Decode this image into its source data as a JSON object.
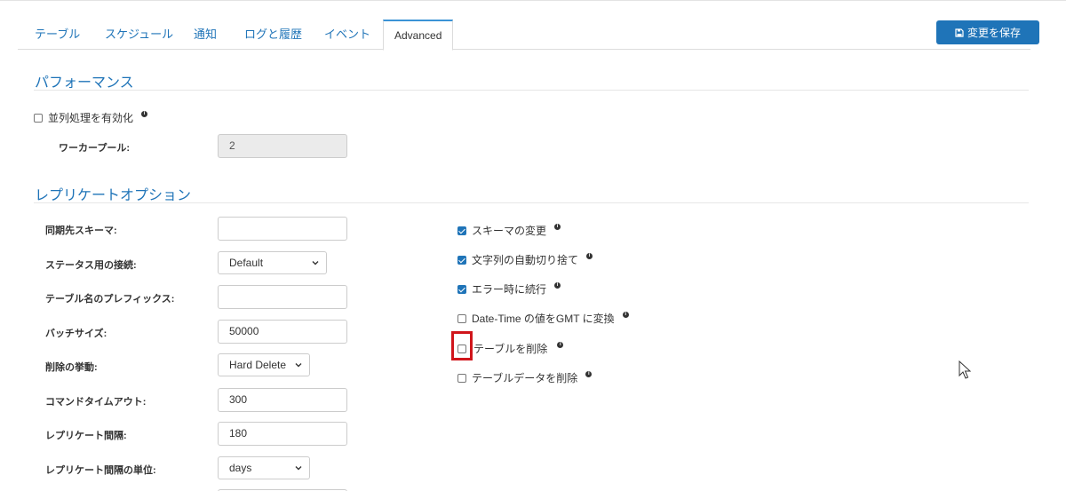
{
  "tabs": [
    "テーブル",
    "スケジュール",
    "通知",
    "ログと履歴",
    "イベント",
    "Advanced"
  ],
  "save_label": "変更を保存",
  "performance": {
    "title": "パフォーマンス",
    "parallel_label": "並列処理を有効化",
    "parallel_checked": false,
    "worker_label": "ワーカープール:",
    "worker_value": "2"
  },
  "replicate": {
    "title": "レプリケートオプション",
    "fields": {
      "dest_schema_label": "同期先スキーマ:",
      "dest_schema_value": "",
      "status_conn_label": "ステータス用の接続:",
      "status_conn_value": "Default",
      "prefix_label": "テーブル名のプレフィックス:",
      "prefix_value": "",
      "batch_label": "バッチサイズ:",
      "batch_value": "50000",
      "delete_label": "削除の挙動:",
      "delete_value": "Hard Delete",
      "timeout_label": "コマンドタイムアウト:",
      "timeout_value": "300",
      "interval_label": "レプリケート間隔:",
      "interval_value": "180",
      "interval_unit_label": "レプリケート間隔の単位:",
      "interval_unit_value": "days"
    },
    "options": [
      {
        "label": "スキーマの変更",
        "checked": true
      },
      {
        "label": "文字列の自動切り捨て",
        "checked": true
      },
      {
        "label": "エラー時に続行",
        "checked": true
      },
      {
        "label": "Date-Time の値をGMT に変換",
        "checked": false
      },
      {
        "label": "テーブルを削除",
        "checked": false
      },
      {
        "label": "テーブルデータを削除",
        "checked": false
      }
    ]
  },
  "colors": {
    "accent": "#1f74b8",
    "highlight": "#d0151b"
  },
  "icons": {
    "save": "floppy-disk-icon",
    "info": "info-icon",
    "chevron": "chevron-down-icon"
  }
}
